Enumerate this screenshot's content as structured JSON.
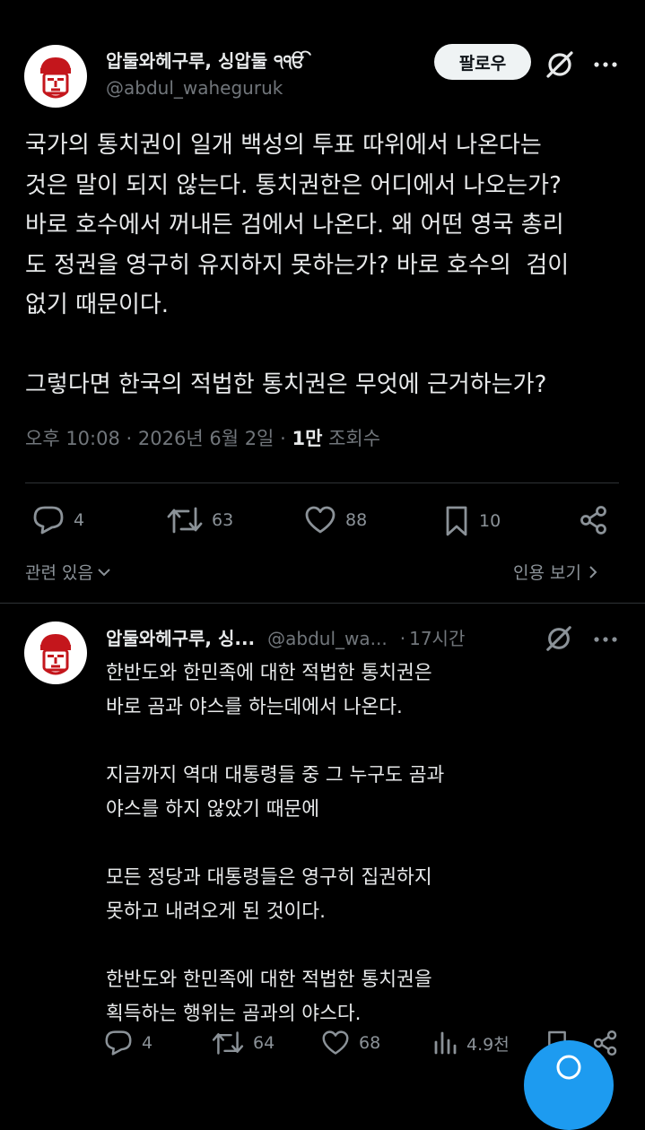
{
  "post": {
    "display_name": "압둘와헤구루, 싱압둘 ੧ੴ",
    "handle": "@abdul_waheguruk",
    "follow_label": "팔로우",
    "text": "국가의 통치권이 일개 백성의 투표 따위에서 나온다는\n것은 말이 되지 않는다. 통치권한은 어디에서 나오는가?\n바로 호수에서 꺼내든 검에서 나온다. 왜 어떤 영국 총리\n도 정권을 영구히 유지하지 못하는가? 바로 호수의  검이\n없기 때문이다.\n\n그렇다면 한국의 적법한 통치권은 무엇에 근거하는가?",
    "time": "오후 10:08",
    "date": "2026년 6월 2일",
    "views_count": "1만",
    "views_label": "조회수",
    "sep": "·",
    "actions": {
      "replies": "4",
      "reposts": "63",
      "likes": "88",
      "bookmarks": "10"
    },
    "related_label": "관련 있음",
    "quotes_label": "인용 보기"
  },
  "reply": {
    "display_name": "압둘와헤구루, 싱...",
    "handle": "@abdul_wa...",
    "time": "17시간",
    "text": "한반도와 한민족에 대한 적법한 통치권은\n바로 곰과 야스를 하는데에서 나온다.\n\n지금까지 역대 대통령들 중 그 누구도 곰과\n야스를 하지 않았기 때문에\n\n모든 정당과 대통령들은 영구히 집권하지\n못하고 내려오게 된 것이다.\n\n한반도와 한민족에 대한 적법한 통치권을\n획득하는 행위는 곰과의 야스다.",
    "actions": {
      "replies": "4",
      "reposts": "64",
      "likes": "68",
      "views": "4.9천"
    }
  },
  "colors": {
    "background": "#000000",
    "text": "#e7e9ea",
    "muted": "#71767b",
    "accent": "#1d9bf0",
    "avatar_red": "#c4161c"
  }
}
